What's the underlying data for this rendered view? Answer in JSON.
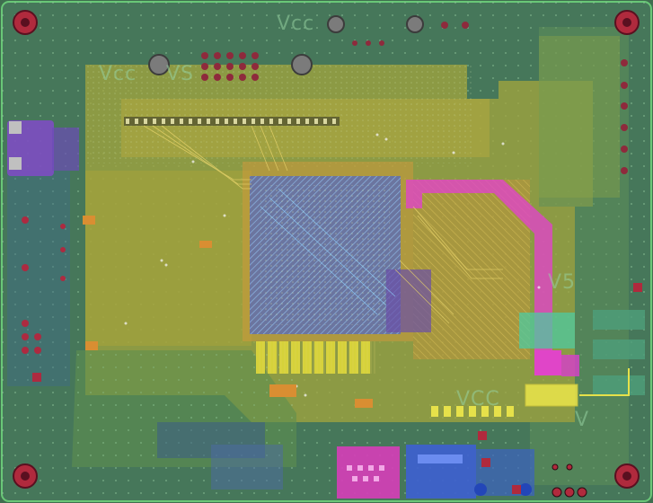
{
  "colors": {
    "board_base": "#4a7a58",
    "board_edge": "#69c777",
    "copper_top": "#a8a83a",
    "copper_mid": "#c4b23d",
    "bga_blue": "#5f6fb0",
    "magenta": "#e045c8",
    "purple": "#7d4dc2",
    "yellow": "#e6e14a",
    "orange": "#d99a3a",
    "cyan_green": "#4ec9a0",
    "mount_hole": "#b02a3d"
  },
  "silk_labels": [
    {
      "id": "vcc-top-left",
      "text": "Vcc"
    },
    {
      "id": "vs-top-left",
      "text": "VS"
    },
    {
      "id": "vcc-top-center",
      "text": "Vcc"
    },
    {
      "id": "vcc-center-right",
      "text": "VCC"
    },
    {
      "id": "vs-right",
      "text": "V5"
    },
    {
      "id": "v-right-lower",
      "text": "V"
    }
  ],
  "icons": [
    "mount-hole-icon",
    "bga-chip-icon",
    "connector-icon",
    "via-icon"
  ]
}
